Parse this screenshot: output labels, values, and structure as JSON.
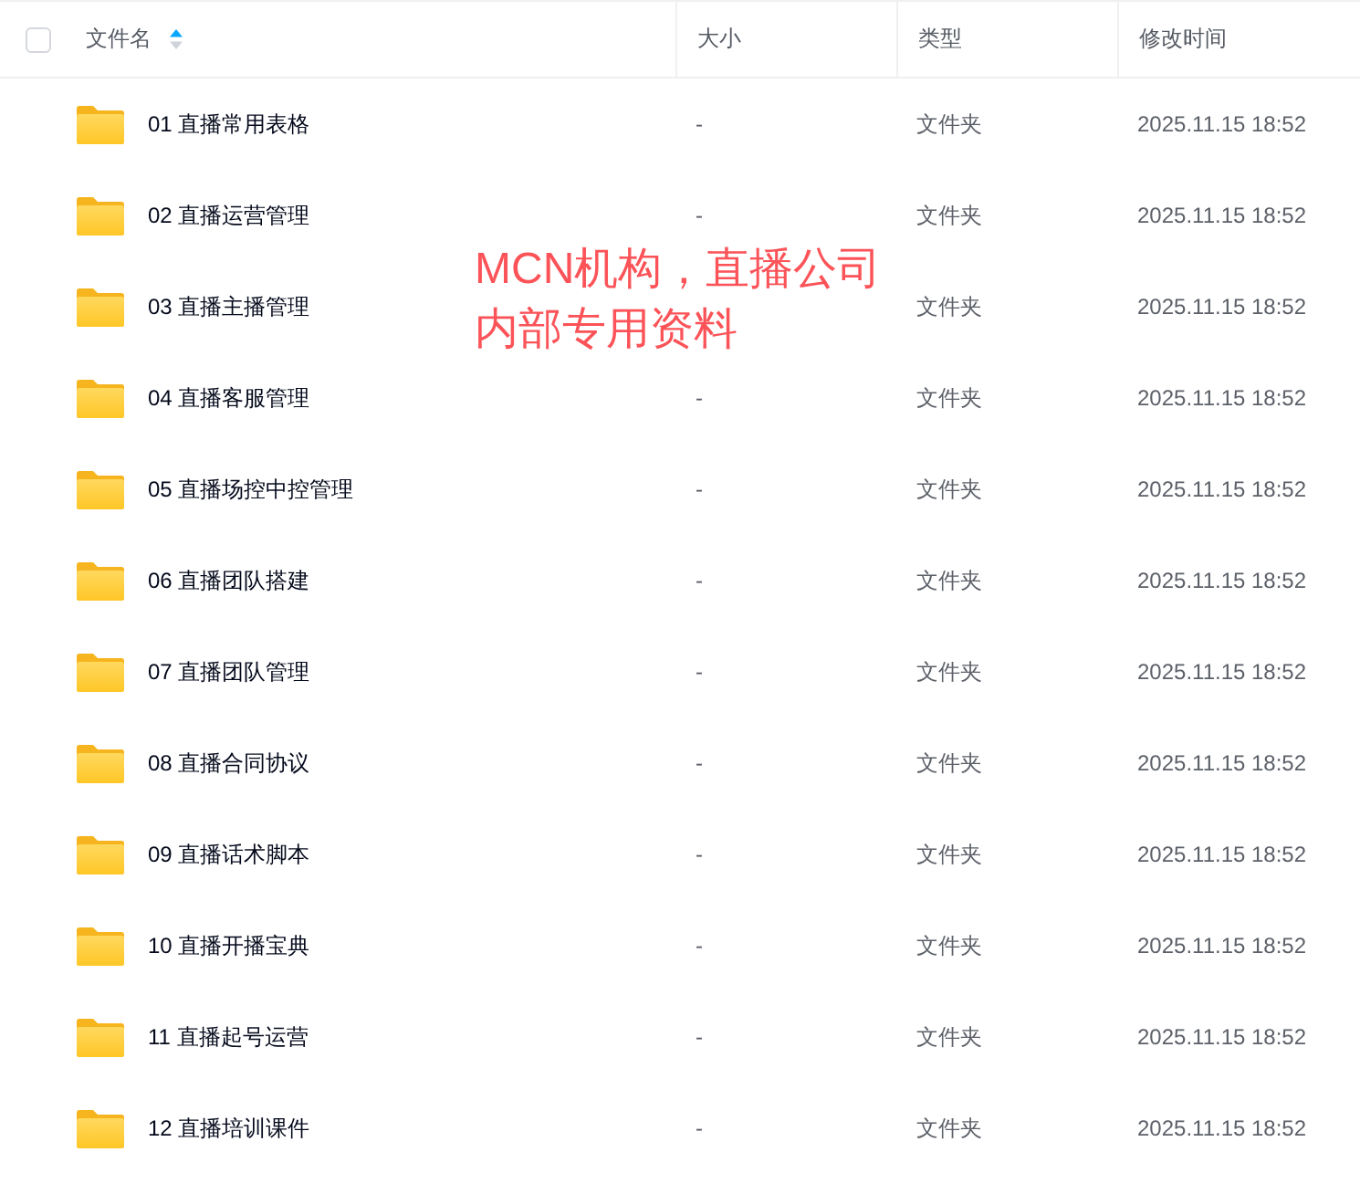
{
  "header": {
    "select_all": {
      "checked": false
    },
    "columns": [
      {
        "label": "文件名",
        "sorted": true
      },
      {
        "label": "大小"
      },
      {
        "label": "类型"
      },
      {
        "label": "修改时间"
      }
    ]
  },
  "rows": [
    {
      "kind": "folder",
      "name": "01 直播常用表格",
      "size": "-",
      "type": "文件夹",
      "modified": "2025.11.15 18:52"
    },
    {
      "kind": "folder",
      "name": "02 直播运营管理",
      "size": "-",
      "type": "文件夹",
      "modified": "2025.11.15 18:52"
    },
    {
      "kind": "folder",
      "name": "03 直播主播管理",
      "type": "文件夹",
      "modified": "2025.11.15 18:52"
    },
    {
      "kind": "folder",
      "name": "04 直播客服管理",
      "size": "-",
      "type": "文件夹",
      "modified": "2025.11.15 18:52"
    },
    {
      "kind": "folder",
      "name": "05 直播场控中控管理",
      "size": "-",
      "type": "文件夹",
      "modified": "2025.11.15 18:52"
    },
    {
      "kind": "folder",
      "name": "06 直播团队搭建",
      "size": "-",
      "type": "文件夹",
      "modified": "2025.11.15 18:52"
    },
    {
      "kind": "folder",
      "name": "07 直播团队管理",
      "size": "-",
      "type": "文件夹",
      "modified": "2025.11.15 18:52"
    },
    {
      "kind": "folder",
      "name": "08 直播合同协议",
      "size": "-",
      "type": "文件夹",
      "modified": "2025.11.15 18:52"
    },
    {
      "kind": "folder",
      "name": "09 直播话术脚本",
      "size": "-",
      "type": "文件夹",
      "modified": "2025.11.15 18:52"
    },
    {
      "kind": "folder",
      "name": "10 直播开播宝典",
      "size": "-",
      "type": "文件夹",
      "modified": "2025.11.15 18:52"
    },
    {
      "kind": "folder",
      "name": "11 直播起号运营",
      "size": "-",
      "type": "文件夹",
      "modified": "2025.11.15 18:52"
    },
    {
      "kind": "folder",
      "name": "12 直播培训课件",
      "size": "-",
      "type": "文件夹",
      "modified": "2025.11.15 18:52"
    }
  ],
  "overlay_note": {
    "lines": [
      "MCN机构，直播公司",
      "内部专用资料"
    ]
  }
}
